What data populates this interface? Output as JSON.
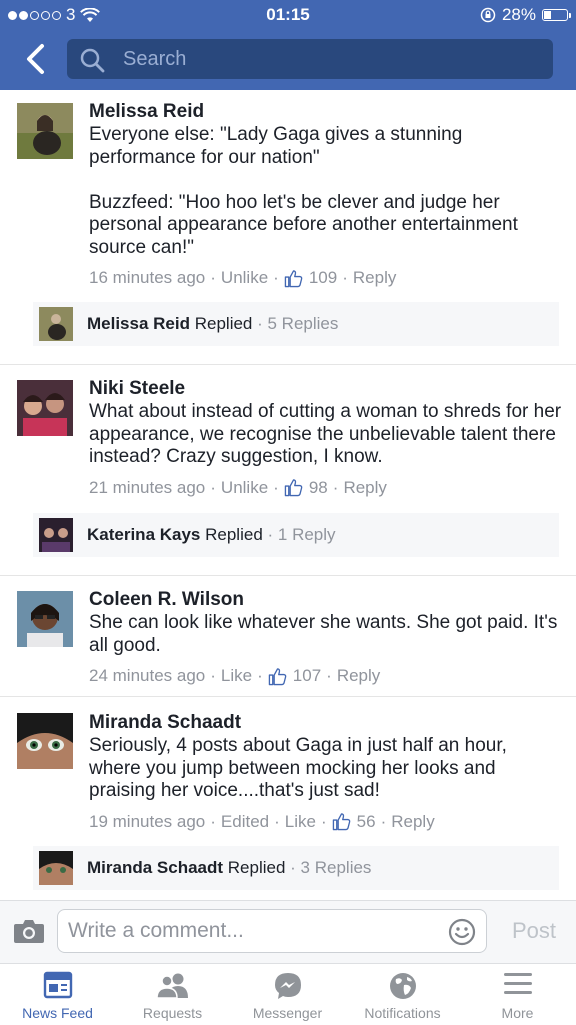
{
  "status_bar": {
    "carrier": "3",
    "time": "01:15",
    "battery": "28%",
    "battery_level": 0.28
  },
  "search": {
    "placeholder": "Search"
  },
  "comments": [
    {
      "author": "Melissa Reid",
      "text": "Everyone else: \"Lady Gaga gives a stunning performance for our nation\"\n\nBuzzfeed: \"Hoo hoo let's be clever and judge her personal appearance before another entertainment source can!\"",
      "time": "16 minutes ago",
      "like_action": "Unlike",
      "likes": "109",
      "reply_action": "Reply",
      "replies_bar": {
        "author": "Melissa Reid",
        "action": "Replied",
        "count": "5 Replies"
      }
    },
    {
      "author": "Niki Steele",
      "text": "What about instead of cutting a woman to shreds for her appearance, we recognise the unbelievable talent there instead? Crazy suggestion, I know.",
      "time": "21 minutes ago",
      "like_action": "Unlike",
      "likes": "98",
      "reply_action": "Reply",
      "replies_bar": {
        "author": "Katerina Kays",
        "action": "Replied",
        "count": "1 Reply"
      }
    },
    {
      "author": "Coleen R. Wilson",
      "text": "She can look like whatever she wants.  She got paid. It's all good.",
      "time": "24 minutes ago",
      "like_action": "Like",
      "likes": "107",
      "reply_action": "Reply"
    },
    {
      "author": "Miranda Schaadt",
      "text": "Seriously, 4 posts about Gaga in just half an hour, where you jump between mocking her looks and praising her voice....that's just sad!",
      "time": "19 minutes ago",
      "edited": "Edited",
      "like_action": "Like",
      "likes": "56",
      "reply_action": "Reply",
      "replies_bar": {
        "author": "Miranda Schaadt",
        "action": "Replied",
        "count": "3 Replies"
      }
    }
  ],
  "composer": {
    "placeholder": "Write a comment...",
    "post_label": "Post"
  },
  "tabs": [
    {
      "label": "News Feed",
      "icon": "news-feed-icon",
      "active": true
    },
    {
      "label": "Requests",
      "icon": "friend-requests-icon",
      "active": false
    },
    {
      "label": "Messenger",
      "icon": "messenger-icon",
      "active": false
    },
    {
      "label": "Notifications",
      "icon": "globe-icon",
      "active": false
    },
    {
      "label": "More",
      "icon": "menu-icon",
      "active": false
    }
  ],
  "colors": {
    "brand": "#4267b2",
    "like_blue": "#4267b2",
    "meta_gray": "#90949c"
  }
}
